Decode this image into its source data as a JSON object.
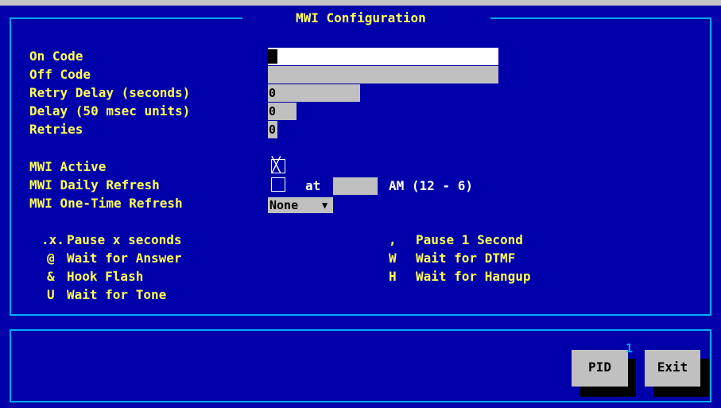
{
  "title": "MWI Configuration",
  "fields": {
    "on_code_label": "On Code",
    "off_code_label": "Off Code",
    "retry_delay_label": "Retry Delay (seconds)",
    "retry_delay_value": "0",
    "delay_label": "Delay (50 msec units)",
    "delay_value": "0",
    "retries_label": "Retries",
    "retries_value": "0"
  },
  "options": {
    "mwi_active_label": "MWI Active",
    "mwi_active_checked": true,
    "daily_refresh_label": "MWI Daily Refresh",
    "daily_refresh_checked": false,
    "at_label": "at",
    "am_range": "AM (12 - 6)",
    "one_time_refresh_label": "MWI One-Time Refresh",
    "one_time_refresh_value": "None",
    "check_mark": "╳"
  },
  "legend": {
    "left": [
      {
        "key": ".x.",
        "desc": "Pause x seconds"
      },
      {
        "key": "@",
        "desc": "Wait for Answer"
      },
      {
        "key": "&",
        "desc": "Hook Flash"
      },
      {
        "key": "U",
        "desc": "Wait for Tone"
      }
    ],
    "right": [
      {
        "key": ",",
        "desc": "Pause 1 Second"
      },
      {
        "key": "W",
        "desc": "Wait for DTMF"
      },
      {
        "key": "H",
        "desc": "Wait for Hangup"
      }
    ]
  },
  "buttons": {
    "pid_label": "PID",
    "pid_badge": "1",
    "exit_label": "Exit"
  },
  "colors": {
    "background": "#0000aa",
    "border": "#00aaff",
    "label_text": "#ffff55",
    "field": "#c0c0c0"
  }
}
